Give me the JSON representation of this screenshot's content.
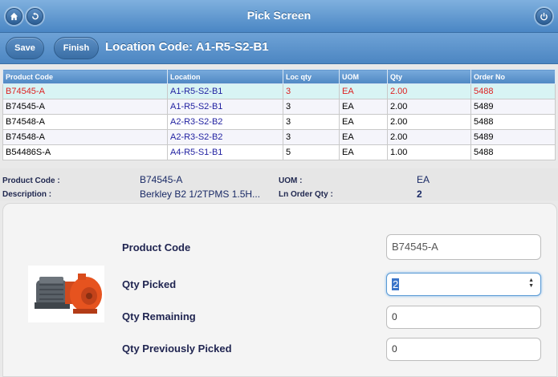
{
  "header": {
    "title": "Pick Screen"
  },
  "toolbar": {
    "save_label": "Save",
    "finish_label": "Finish",
    "location_title": "Location Code: A1-R5-S2-B1"
  },
  "icons": {
    "home": "home-icon",
    "back": "back-icon",
    "power": "power-icon"
  },
  "colors": {
    "header_blue": "#4a86c4",
    "selected_row": "#d8f4f4",
    "selected_text": "#dd2222",
    "location_text": "#1f1fa0"
  },
  "table": {
    "columns": [
      "Product Code",
      "Location",
      "Loc qty",
      "UOM",
      "Qty",
      "Order No"
    ],
    "rows": [
      {
        "product_code": "B74545-A",
        "location": "A1-R5-S2-B1",
        "loc_qty": "3",
        "uom": "EA",
        "qty": "2.00",
        "order_no": "5488"
      },
      {
        "product_code": "B74545-A",
        "location": "A1-R5-S2-B1",
        "loc_qty": "3",
        "uom": "EA",
        "qty": "2.00",
        "order_no": "5489"
      },
      {
        "product_code": "B74548-A",
        "location": "A2-R3-S2-B2",
        "loc_qty": "3",
        "uom": "EA",
        "qty": "2.00",
        "order_no": "5488"
      },
      {
        "product_code": "B74548-A",
        "location": "A2-R3-S2-B2",
        "loc_qty": "3",
        "uom": "EA",
        "qty": "2.00",
        "order_no": "5489"
      },
      {
        "product_code": "B54486S-A",
        "location": "A4-R5-S1-B1",
        "loc_qty": "5",
        "uom": "EA",
        "qty": "1.00",
        "order_no": "5488"
      }
    ]
  },
  "details": {
    "product_code_label": "Product Code :",
    "product_code_value": "B74545-A",
    "description_label": "Description :",
    "description_value": "Berkley B2 1/2TPMS 1.5H...",
    "uom_label": "UOM :",
    "uom_value": "EA",
    "ln_order_qty_label": "Ln Order Qty :",
    "ln_order_qty_value": "2"
  },
  "form": {
    "product_code_label": "Product Code",
    "product_code_value": "B74545-A",
    "qty_picked_label": "Qty Picked",
    "qty_picked_value": "2",
    "qty_remaining_label": "Qty Remaining",
    "qty_remaining_value": "0",
    "qty_prev_label": "Qty Previously Picked",
    "qty_prev_value": "0"
  }
}
